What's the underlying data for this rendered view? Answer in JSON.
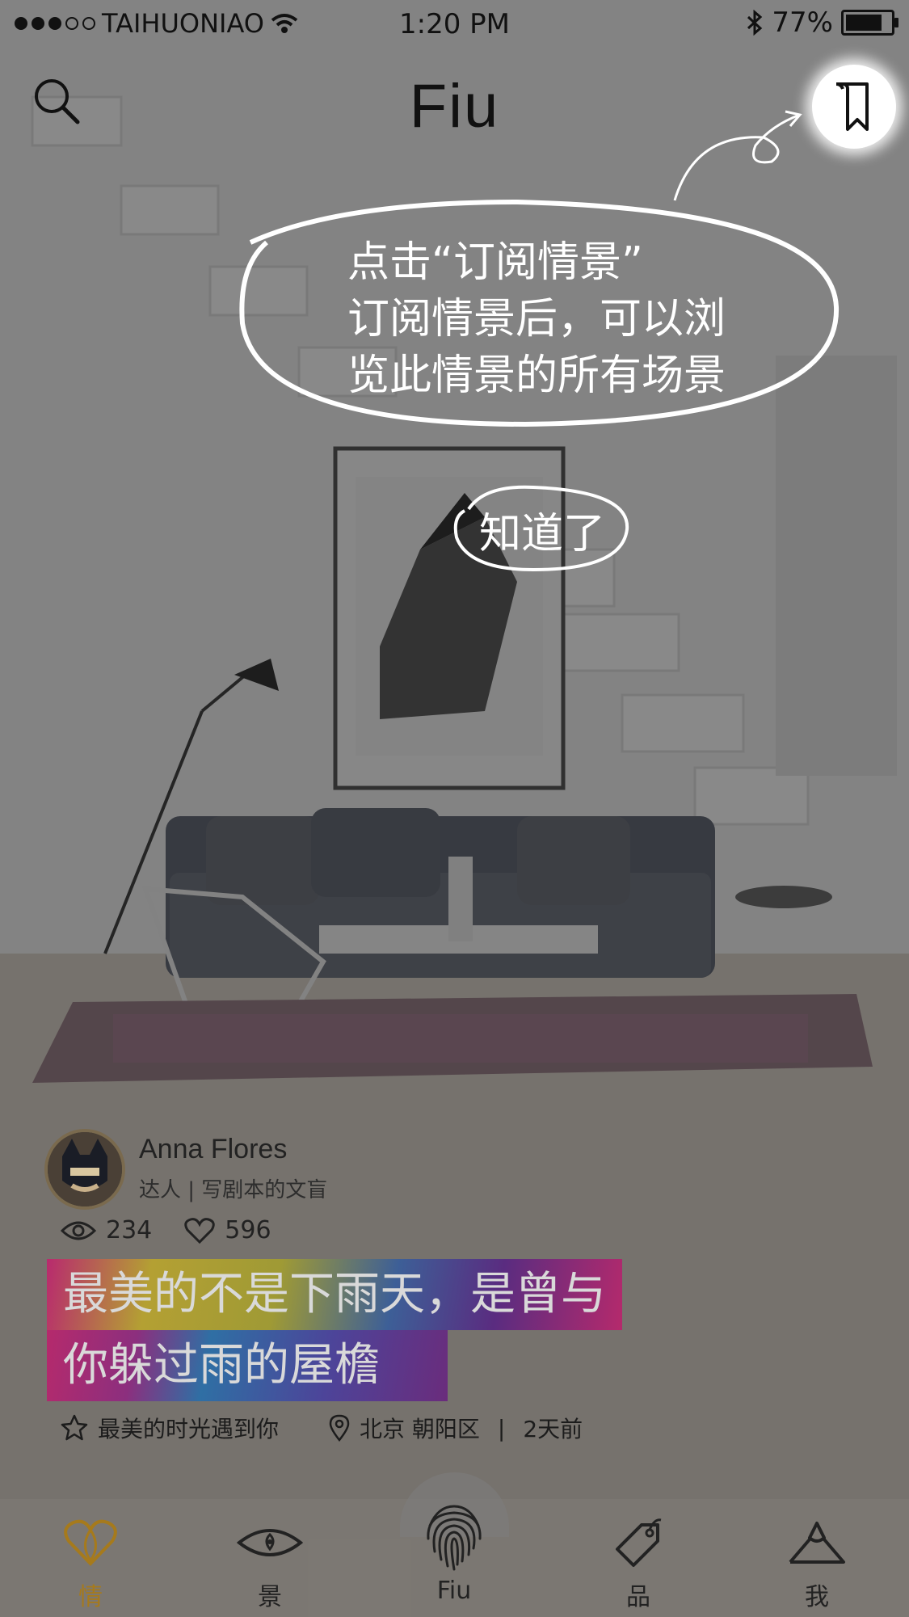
{
  "status_bar": {
    "carrier": "TAIHUONIAO",
    "time": "1:20 PM",
    "battery": "77%"
  },
  "header": {
    "logo": "Fiu"
  },
  "overlay": {
    "title": "点击“订阅情景”",
    "line1": "订阅情景后，可以浏",
    "line2": "览此情景的所有场景",
    "ok_button": "知道了"
  },
  "post": {
    "author_name": "Anna Flores",
    "author_tags": "达人 | 写剧本的文盲",
    "views": "234",
    "likes": "596",
    "title_line1": "最美的不是下雨天，是曾与",
    "title_line2": "你躲过雨的屋檐",
    "scene": "最美的时光遇到你",
    "location": "北京 朝阳区",
    "divider": "|",
    "time_ago": "2天前"
  },
  "tabbar": {
    "tabs": [
      {
        "label": "情",
        "icon": "heart-icon"
      },
      {
        "label": "景",
        "icon": "eye-icon"
      },
      {
        "label": "Fiu",
        "icon": "fingerprint-icon"
      },
      {
        "label": "品",
        "icon": "tag-icon"
      },
      {
        "label": "我",
        "icon": "person-icon"
      }
    ],
    "active_color": "#a67a1c"
  }
}
